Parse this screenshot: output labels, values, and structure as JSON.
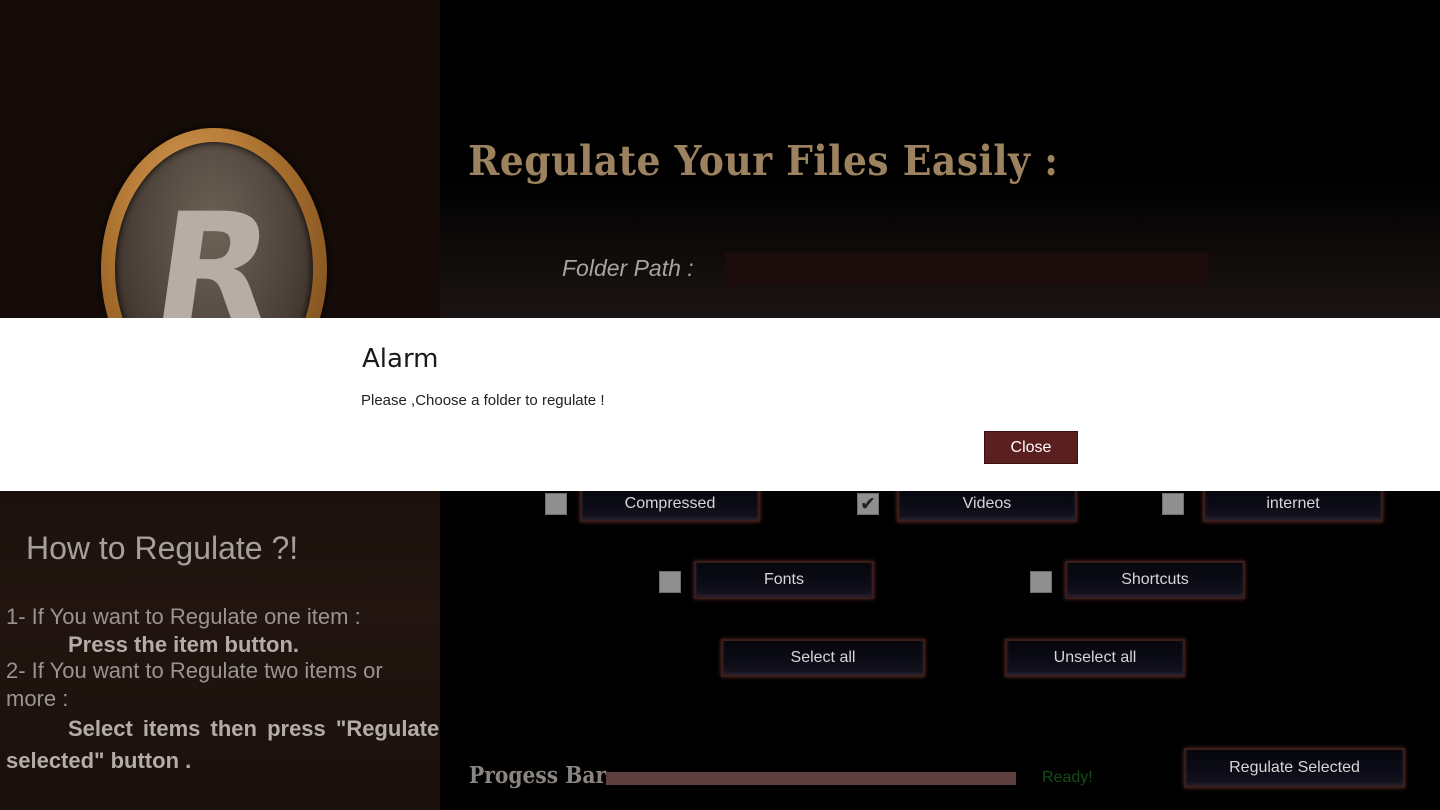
{
  "header": {
    "title": "Regulate Your Files Easily :",
    "folder_label": "Folder Path :",
    "folder_value": ""
  },
  "logo": {
    "letter": "R"
  },
  "categories": [
    {
      "label": "Compressed",
      "checked": false
    },
    {
      "label": "Videos",
      "checked": true
    },
    {
      "label": "internet",
      "checked": false
    },
    {
      "label": "Fonts",
      "checked": false
    },
    {
      "label": "Shortcuts",
      "checked": false
    }
  ],
  "actions": {
    "select_all": "Select all",
    "unselect_all": "Unselect all",
    "regulate_selected": "Regulate Selected"
  },
  "howto": {
    "title": "How to Regulate ?!",
    "line1": "1- If You want to Regulate one item :",
    "line2": "Press the item button.",
    "line3": "2- If You want to Regulate two items or",
    "line4": "more :",
    "line5": "Select items  then  press \"Regulate",
    "line6": "selected\" button ."
  },
  "progress": {
    "label": "Progess Bar",
    "value": 1.0,
    "status": "Ready!",
    "status_color": "#164e16"
  },
  "dialog": {
    "title": "Alarm",
    "message": "Please ,Choose a folder to regulate !",
    "close_label": "Close"
  },
  "colors": {
    "accent": "#5a1f1f",
    "title": "#9d8260"
  }
}
